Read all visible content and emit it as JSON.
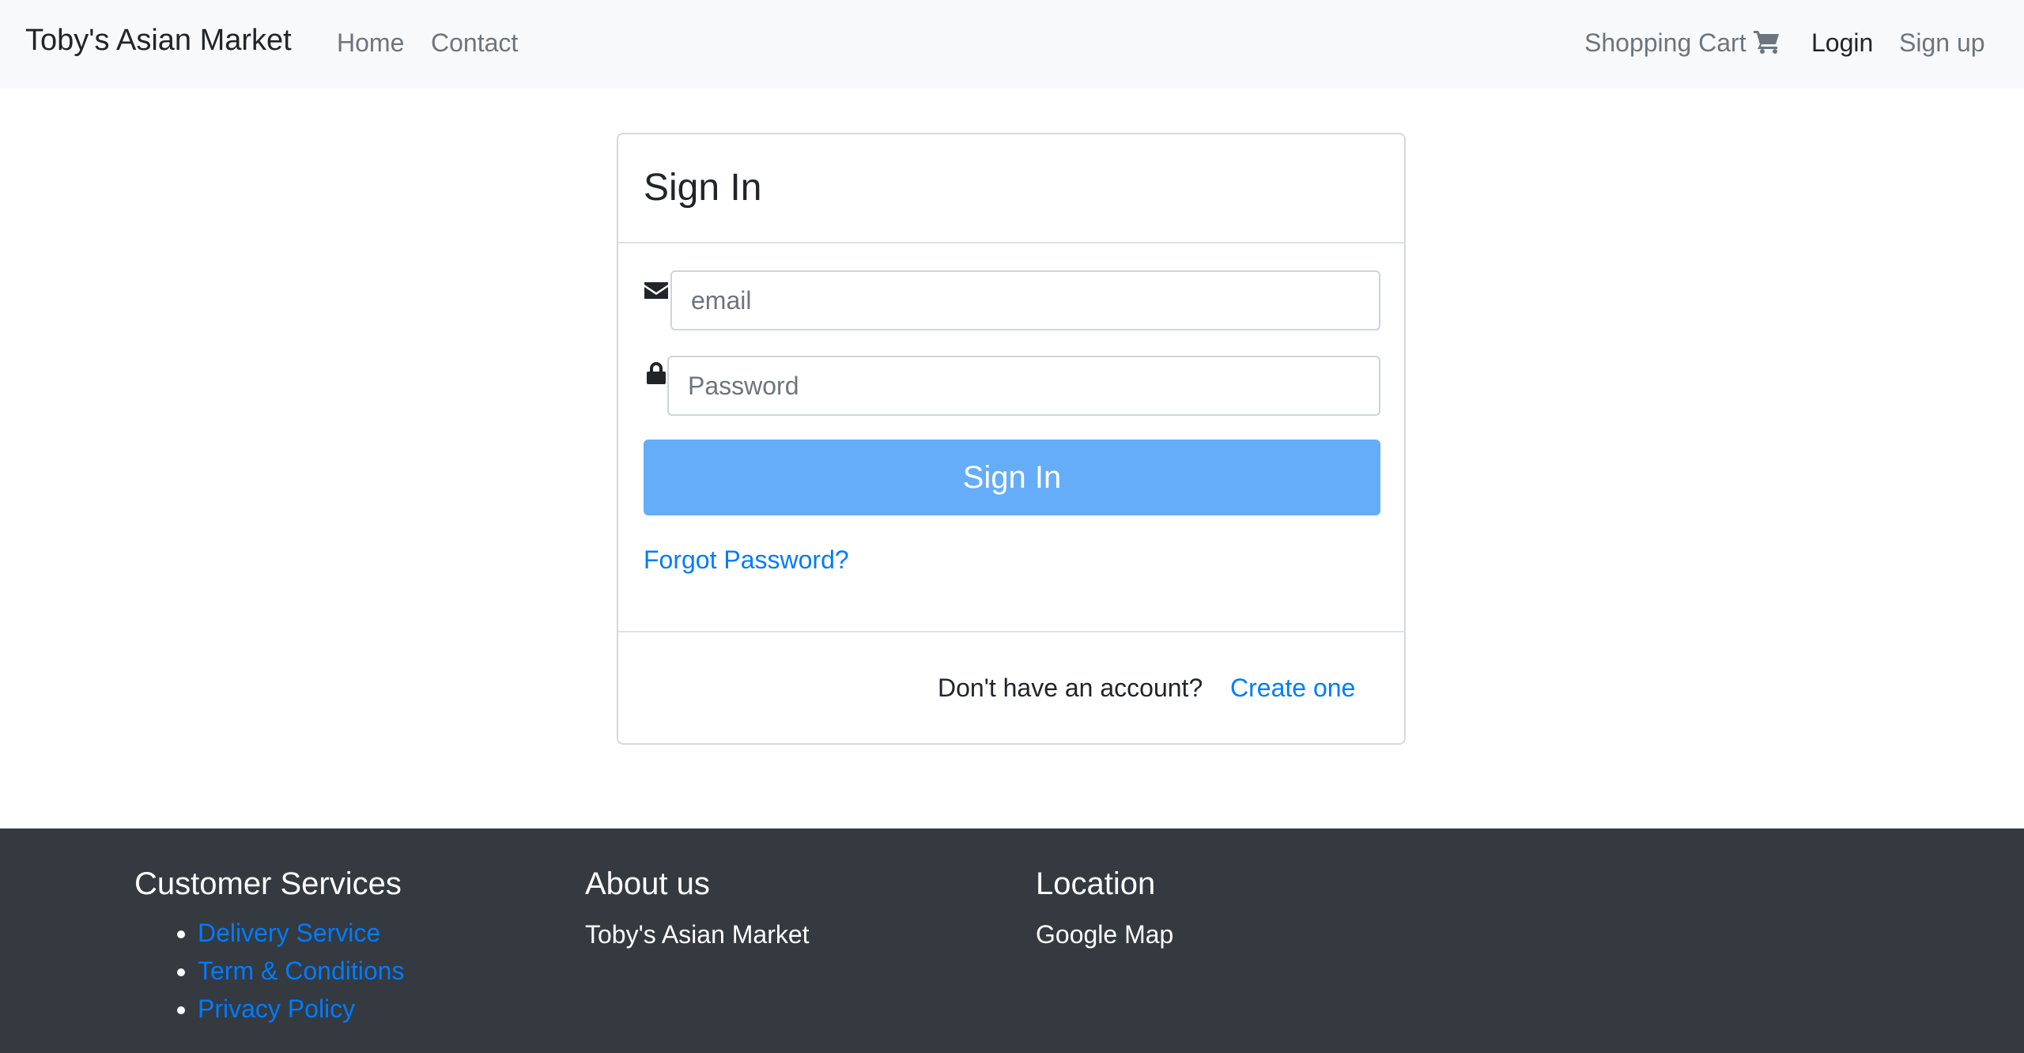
{
  "navbar": {
    "brand": "Toby's Asian Market",
    "links": {
      "home": "Home",
      "contact": "Contact",
      "cart": "Shopping Cart",
      "login": "Login",
      "signup": "Sign up"
    }
  },
  "signin_card": {
    "title": "Sign In",
    "email_placeholder": "email",
    "password_placeholder": "Password",
    "submit_label": "Sign In",
    "forgot_label": "Forgot Password?",
    "no_account_text": "Don't have an account?",
    "create_label": "Create one"
  },
  "footer": {
    "customer_services": {
      "title": "Customer Services",
      "links": [
        "Delivery Service",
        "Term & Conditions",
        "Privacy Policy"
      ]
    },
    "about": {
      "title": "About us",
      "text": "Toby's Asian Market"
    },
    "location": {
      "title": "Location",
      "text": "Google Map"
    }
  },
  "icons": {
    "cart": "shopping-cart-icon",
    "email": "envelope-icon",
    "password": "lock-icon"
  },
  "colors": {
    "navbar_bg": "#f8f9fa",
    "footer_bg": "#343a40",
    "primary_button": "#66adf9",
    "link": "#007bff"
  }
}
